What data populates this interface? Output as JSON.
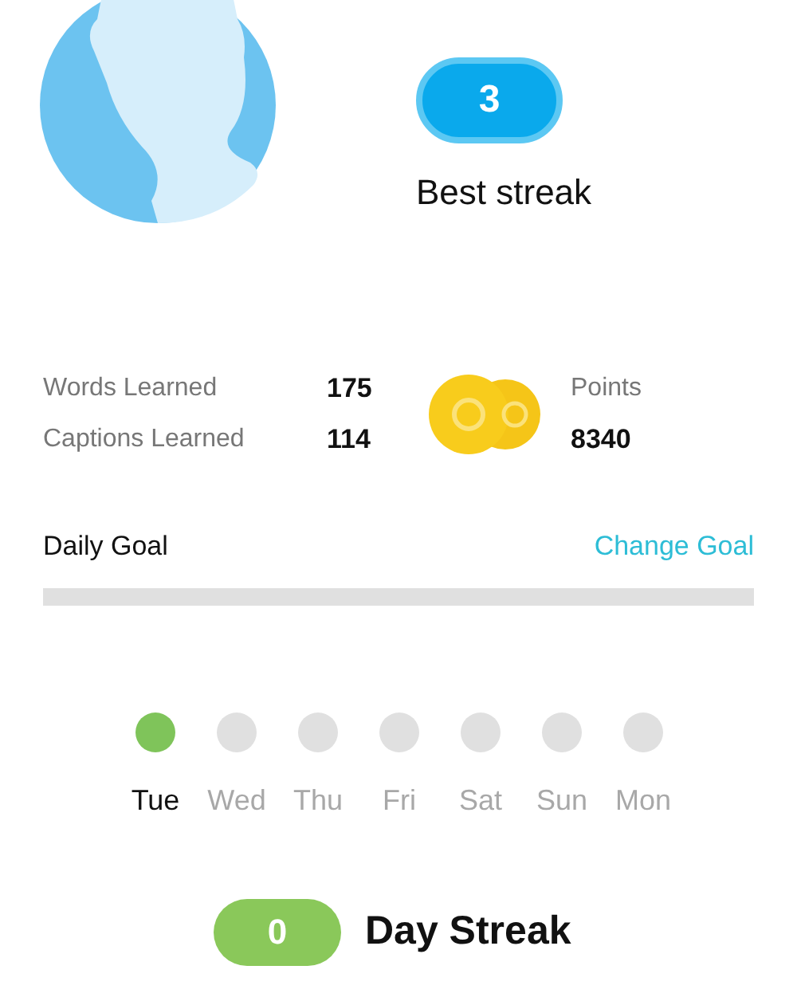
{
  "best_streak": {
    "value": "3",
    "label": "Best streak"
  },
  "stats": [
    {
      "label": "Words Learned",
      "value": "175"
    },
    {
      "label": "Captions Learned",
      "value": "114"
    }
  ],
  "points": {
    "label": "Points",
    "value": "8340"
  },
  "daily_goal": {
    "title": "Daily Goal",
    "action": "Change Goal",
    "level": 0
  },
  "days": [
    {
      "label": "Tue",
      "done": true
    },
    {
      "label": "Wed",
      "done": false
    },
    {
      "label": "Thu",
      "done": false
    },
    {
      "label": "Fri",
      "done": false
    },
    {
      "label": "Sat",
      "done": false
    },
    {
      "label": "Sun",
      "done": false
    },
    {
      "label": "Mon",
      "done": false
    }
  ],
  "day_streak": {
    "value": "0",
    "label": "Day Streak"
  }
}
